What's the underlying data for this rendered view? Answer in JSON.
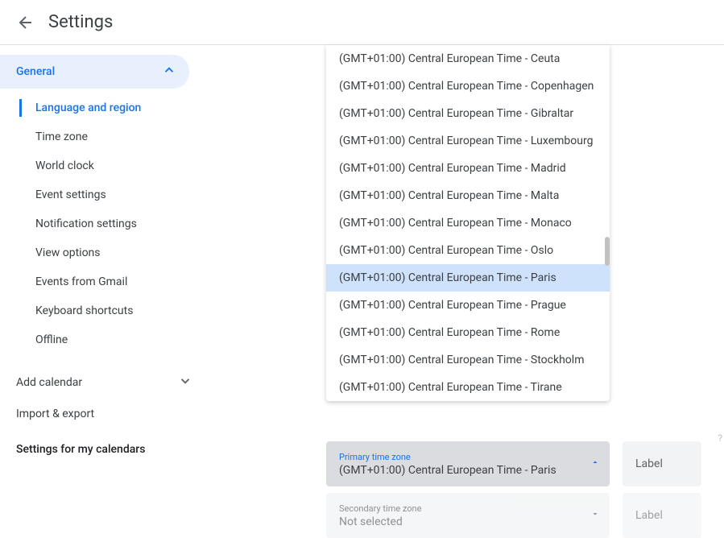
{
  "header": {
    "title": "Settings"
  },
  "sidebar": {
    "section": {
      "label": "General"
    },
    "items": [
      {
        "label": "Language and region",
        "active": true
      },
      {
        "label": "Time zone",
        "active": false
      },
      {
        "label": "World clock",
        "active": false
      },
      {
        "label": "Event settings",
        "active": false
      },
      {
        "label": "Notification settings",
        "active": false
      },
      {
        "label": "View options",
        "active": false
      },
      {
        "label": "Events from Gmail",
        "active": false
      },
      {
        "label": "Keyboard shortcuts",
        "active": false
      },
      {
        "label": "Offline",
        "active": false
      }
    ],
    "add_calendar": "Add calendar",
    "import_export": "Import & export",
    "my_calendars_heading": "Settings for my calendars"
  },
  "timezone_dropdown": {
    "options": [
      "(GMT+01:00) Central European Time - Ceuta",
      "(GMT+01:00) Central European Time - Copenhagen",
      "(GMT+01:00) Central European Time - Gibraltar",
      "(GMT+01:00) Central European Time - Luxembourg",
      "(GMT+01:00) Central European Time - Madrid",
      "(GMT+01:00) Central European Time - Malta",
      "(GMT+01:00) Central European Time - Monaco",
      "(GMT+01:00) Central European Time - Oslo",
      "(GMT+01:00) Central European Time - Paris",
      "(GMT+01:00) Central European Time - Prague",
      "(GMT+01:00) Central European Time - Rome",
      "(GMT+01:00) Central European Time - Stockholm",
      "(GMT+01:00) Central European Time - Tirane"
    ],
    "selected_index": 8
  },
  "primary_tz": {
    "label": "Primary time zone",
    "value": "(GMT+01:00) Central European Time - Paris",
    "input_placeholder": "Label"
  },
  "secondary_tz": {
    "label": "Secondary time zone",
    "value": "Not selected",
    "input_placeholder": "Label"
  }
}
